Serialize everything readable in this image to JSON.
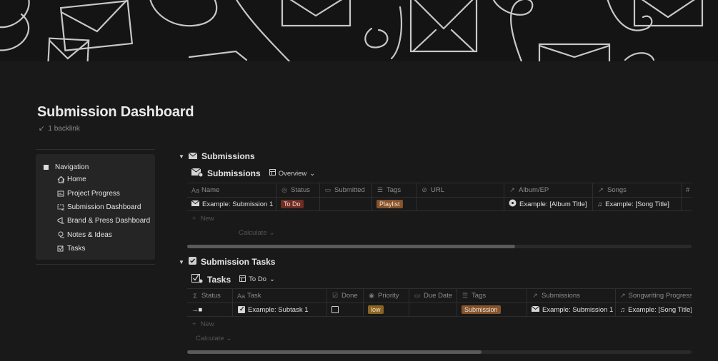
{
  "page": {
    "title": "Submission Dashboard",
    "backlink": "1 backlink"
  },
  "nav": {
    "heading": "Navigation",
    "items": [
      {
        "label": "Home",
        "icon": "house-icon"
      },
      {
        "label": "Project Progress",
        "icon": "chart-icon"
      },
      {
        "label": "Submission Dashboard",
        "icon": "inbox-icon"
      },
      {
        "label": "Brand & Press Dashboard",
        "icon": "megaphone-icon"
      },
      {
        "label": "Notes & Ideas",
        "icon": "lightbulb-icon"
      },
      {
        "label": "Tasks",
        "icon": "checkbox-icon"
      }
    ]
  },
  "submissions": {
    "section_title": "Submissions",
    "db_title": "Submissions",
    "view": "Overview",
    "columns": [
      "Name",
      "Status",
      "Submitted",
      "Tags",
      "URL",
      "Album/EP",
      "Songs",
      "#"
    ],
    "rows": [
      {
        "name": "Example: Submission 1",
        "status": "To Do",
        "submitted": "",
        "tags": "Playlist",
        "url": "",
        "album": "Example: [Album Title]",
        "songs": "Example: [Song Title]"
      }
    ],
    "new_label": "New",
    "calculate_label": "Calculate"
  },
  "tasks": {
    "section_title": "Submission Tasks",
    "db_title": "Tasks",
    "view": "To Do",
    "columns": [
      "Status",
      "Task",
      "Done",
      "Priority",
      "Due Date",
      "Tags",
      "Submissions",
      "Songwriting Progress"
    ],
    "rows": [
      {
        "status": "→■",
        "task": "Example: Subtask 1",
        "done": false,
        "priority": "low",
        "due": "",
        "tags": "Submission",
        "submissions": "Example: Submission 1",
        "songwriting": "Example: [Song Title]"
      }
    ],
    "new_label": "New",
    "calculate_label": "Calculate"
  },
  "colors": {
    "status_todo": "#6e2c22",
    "tag_playlist": "#85532c",
    "tag_submission": "#85532c",
    "priority_low": "#8a6420"
  }
}
